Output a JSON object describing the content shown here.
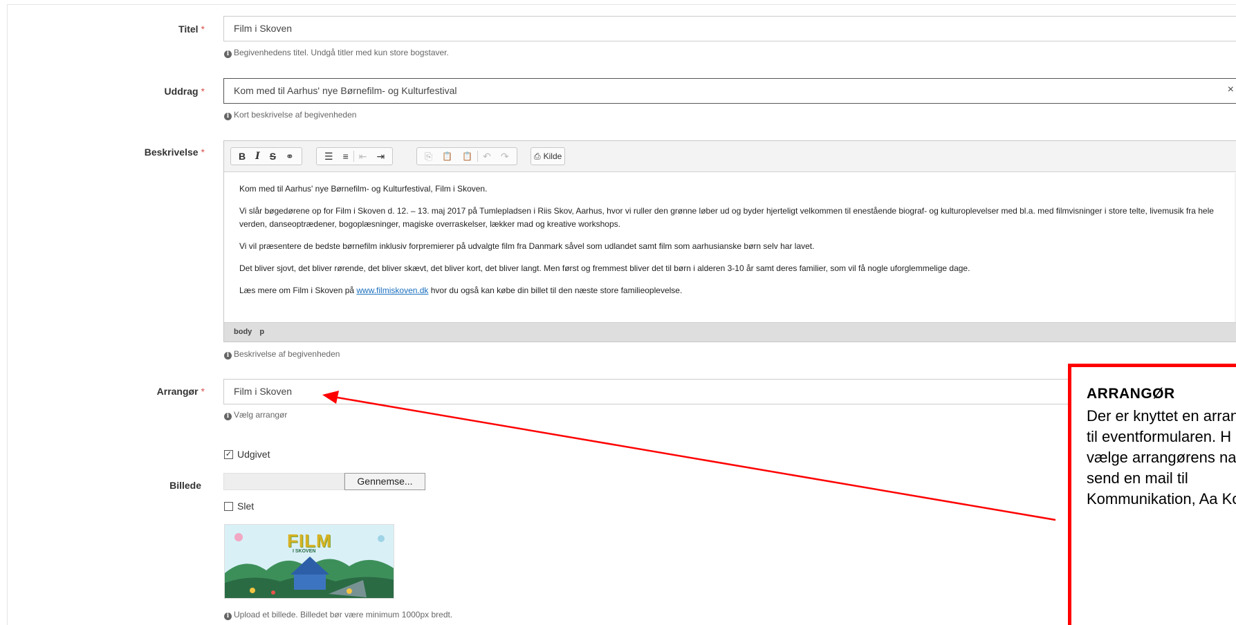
{
  "fields": {
    "titel": {
      "label": "Titel",
      "required": "*",
      "value": "Film i Skoven",
      "help": "Begivenhedens titel. Undgå titler med kun store bogstaver."
    },
    "uddrag": {
      "label": "Uddrag",
      "required": "*",
      "value": "Kom med til Aarhus' nye Børnefilm- og Kulturfestival",
      "clear": "×",
      "help": "Kort beskrivelse af begivenheden"
    },
    "beskrivelse": {
      "label": "Beskrivelse",
      "required": "*",
      "help": "Beskrivelse af begivenheden"
    },
    "arrangor": {
      "label": "Arrangør",
      "required": "*",
      "value": "Film i Skoven",
      "help": "Vælg arrangør"
    },
    "udgivet": {
      "label": "Udgivet",
      "checked": true
    },
    "billede": {
      "label": "Billede",
      "browse_label": "Gennemse...",
      "delete_label": "Slet",
      "help": "Upload et billede. Billedet bør være minimum 1000px bredt."
    }
  },
  "editor": {
    "toolbar": {
      "bold": "B",
      "italic": "I",
      "strike": "S",
      "link": "⚭",
      "bullets": "☰",
      "numbers": "≡",
      "outdent": "⇤",
      "indent": "⇥",
      "copy": "⎘",
      "paste": "📋",
      "paste_text": "📋",
      "undo": "↶",
      "redo": "↷",
      "source_label": "Kilde"
    },
    "paragraphs": [
      "Kom med til Aarhus' nye Børnefilm- og Kulturfestival, Film i Skoven.",
      "Vi slår bøgedørene op for Film i Skoven d. 12. – 13. maj 2017 på Tumlepladsen i Riis Skov, Aarhus, hvor vi ruller den grønne løber ud og byder hjerteligt velkommen til enestående biograf- og kulturoplevelser med bl.a. med filmvisninger i store telte, livemusik fra hele verden, danseoptrædener, bogoplæsninger, magiske overraskelser, lækker mad og kreative workshops.",
      "Vi vil præsentere de bedste børnefilm inklusiv forpremierer på udvalgte film fra Danmark såvel som udlandet samt film som aarhusianske børn selv har lavet.",
      "Det bliver sjovt, det bliver rørende, det bliver skævt, det bliver kort, det bliver langt. Men først og fremmest bliver det til børn i alderen 3-10 år samt deres familier, som vil få nogle uforglemmelige dage."
    ],
    "last_paragraph": {
      "before": "Læs mere om Film i Skoven på ",
      "link": "www.filmiskoven.dk",
      "after": " hvor du også kan købe din billet til den næste store familieoplevelse."
    },
    "path": [
      "body",
      "p"
    ]
  },
  "thumbnail": {
    "logo_text": "FILM",
    "logo_sub": "I SKOVEN"
  },
  "callout": {
    "title": "ARRANGØR",
    "body": "Der er knyttet en arrangørliste til eventformularen. H ikke kan vælge arrangørens navn p så send en mail til Kommunikation, Aa Kommune,",
    "color": "#ff0000"
  }
}
